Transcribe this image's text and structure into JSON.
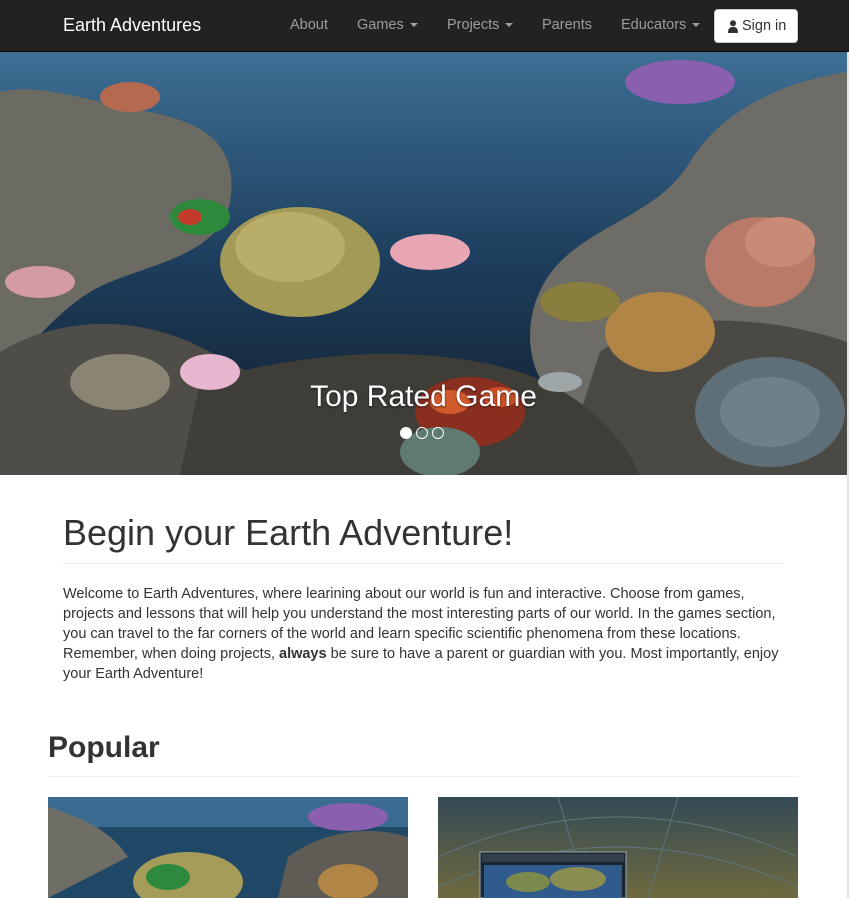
{
  "navbar": {
    "brand": "Earth Adventures",
    "links": {
      "about": "About",
      "games": "Games",
      "projects": "Projects",
      "parents": "Parents",
      "educators": "Educators"
    },
    "signin_label": "Sign in",
    "background": "#222222"
  },
  "carousel": {
    "caption": "Top Rated Game",
    "slide_count": 3,
    "active_slide": 1
  },
  "intro": {
    "title": "Begin your Earth Adventure!",
    "text_before": "Welcome to Earth Adventures, where learining about our world is fun and interactive. Choose from games, projects and lessons that will help you understand the most interesting parts of our world. In the games section, you can travel to the far corners of the world and learn specific scientific phenomena from these locations. Remember, when doing projects, ",
    "text_bold": "always",
    "text_after": " be sure to have a parent or guardian with you. Most importantly, enjoy your Earth Adventure!"
  },
  "popular": {
    "title": "Popular"
  }
}
